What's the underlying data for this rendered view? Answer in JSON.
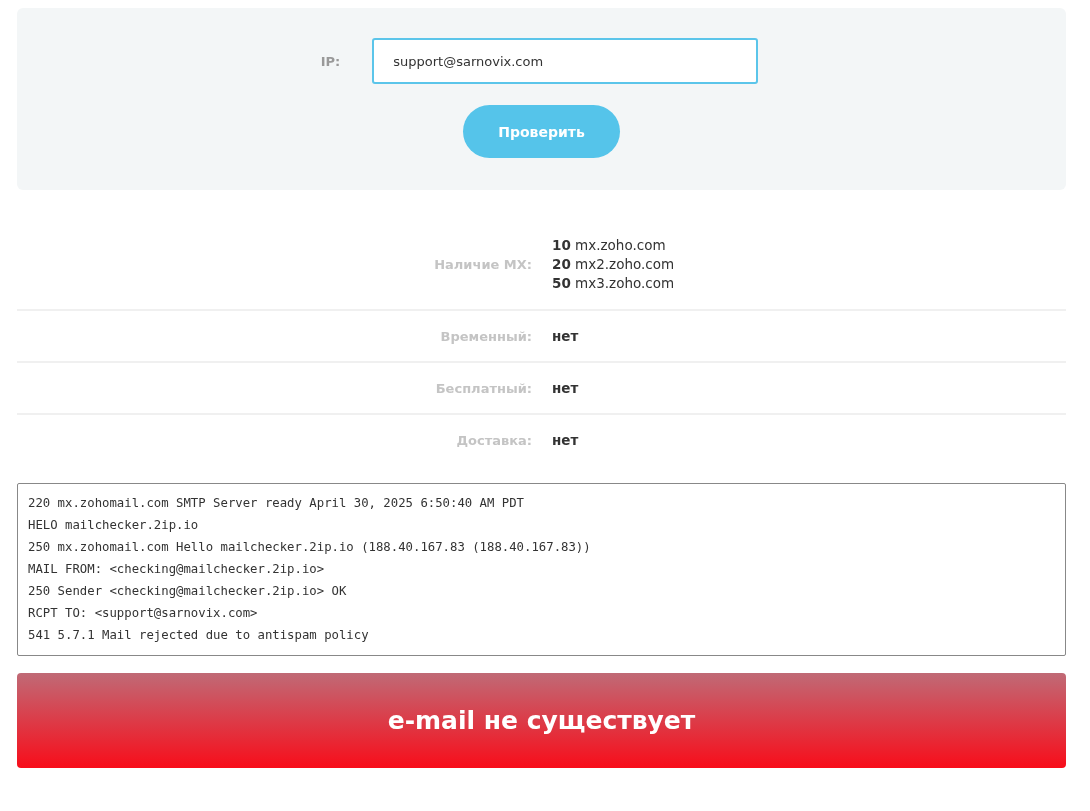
{
  "form": {
    "label": "IP:",
    "value": "support@sarnovix.com",
    "button": "Проверить"
  },
  "results": [
    {
      "label": "Наличие MX:",
      "values": [
        "**10** mx.zoho.com",
        "**20** mx2.zoho.com",
        "**50** mx3.zoho.com"
      ]
    },
    {
      "label": "Временный:",
      "values": [
        "нет"
      ]
    },
    {
      "label": "Бесплатный:",
      "values": [
        "нет"
      ]
    },
    {
      "label": "Доставка:",
      "values": [
        "нет"
      ]
    }
  ],
  "log": [
    "220 mx.zohomail.com SMTP Server ready April 30, 2025 6:50:40 AM PDT",
    "HELO mailchecker.2ip.io",
    "250 mx.zohomail.com Hello mailchecker.2ip.io (188.40.167.83 (188.40.167.83))",
    "MAIL FROM: <checking@mailchecker.2ip.io>",
    "250 Sender <checking@mailchecker.2ip.io> OK",
    "RCPT TO: <support@sarnovix.com>",
    "541 5.7.1 Mail rejected due to antispam policy"
  ],
  "verdict": {
    "text": "e-mail не существует",
    "kind": "error"
  }
}
